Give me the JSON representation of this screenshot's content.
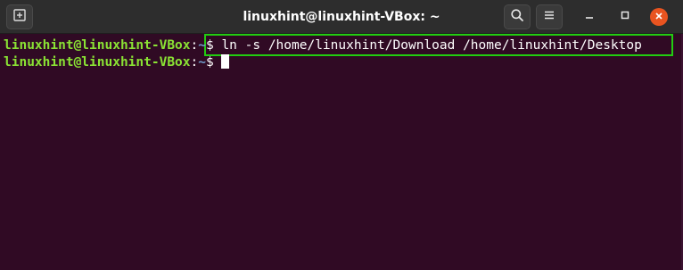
{
  "window": {
    "title": "linuxhint@linuxhint-VBox: ~",
    "icons": {
      "new_tab": "new-tab-icon",
      "search": "search-icon",
      "menu": "hamburger-menu-icon",
      "minimize": "minimize-icon",
      "maximize": "maximize-icon",
      "close": "close-icon"
    },
    "colors": {
      "titlebar_bg": "#2d2d2d",
      "terminal_bg": "#300a24",
      "close_button": "#e95420",
      "prompt_user": "#8ae234",
      "prompt_path": "#729fcf",
      "highlight_box": "#22cc11"
    }
  },
  "terminal": {
    "lines": [
      {
        "user_host": "linuxhint@linuxhint-VBox",
        "separator": ":",
        "path": "~",
        "symbol": "$",
        "command": " ln -s /home/linuxhint/Download /home/linuxhint/Desktop"
      },
      {
        "user_host": "linuxhint@linuxhint-VBox",
        "separator": ":",
        "path": "~",
        "symbol": "$",
        "command": " "
      }
    ]
  }
}
